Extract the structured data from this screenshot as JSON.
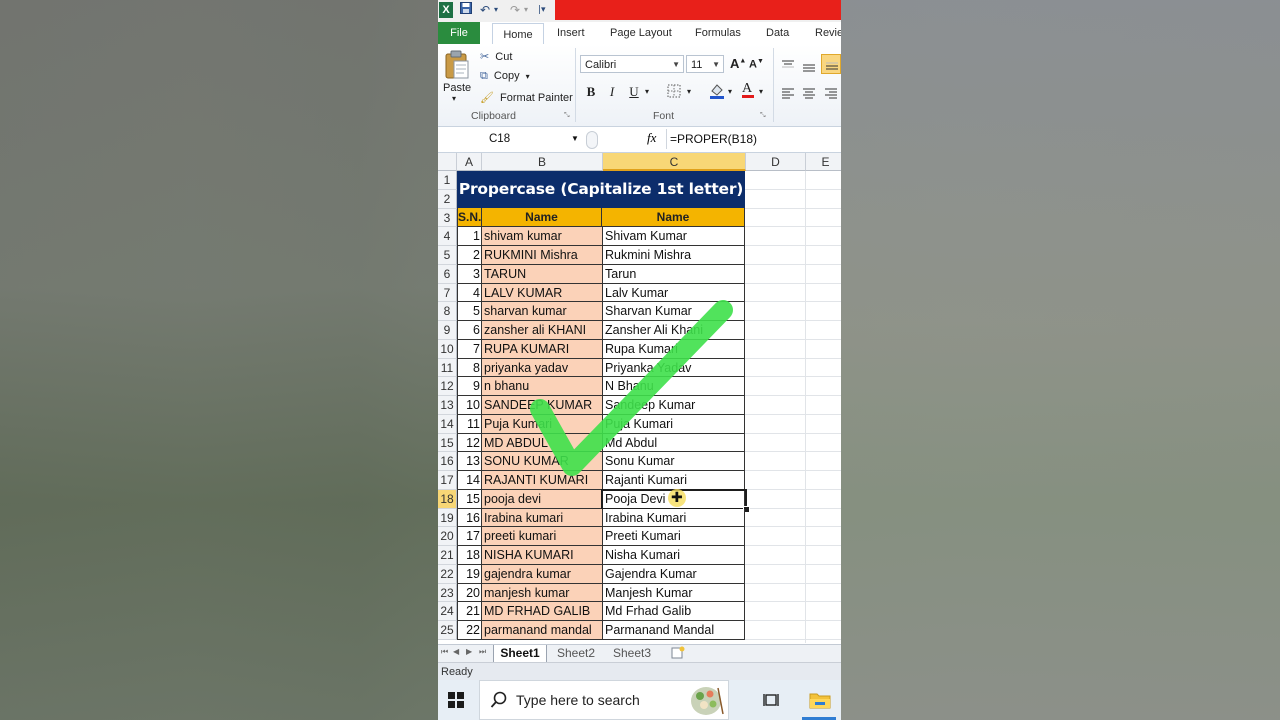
{
  "quick_access": {
    "undo": "↶",
    "redo": "↷"
  },
  "ribbon_tabs": [
    "File",
    "Home",
    "Insert",
    "Page Layout",
    "Formulas",
    "Data",
    "Revie"
  ],
  "clipboard": {
    "paste_label": "Paste",
    "cut_label": "Cut",
    "copy_label": "Copy",
    "format_painter_label": "Format Painter",
    "group_label": "Clipboard"
  },
  "font": {
    "font_name": "Calibri",
    "font_size": "11",
    "bold": "B",
    "italic": "I",
    "underline": "U",
    "group_label": "Font"
  },
  "formula_bar": {
    "name_box": "C18",
    "fx": "fx",
    "formula": "=PROPER(B18)"
  },
  "columns": [
    "A",
    "B",
    "C",
    "D",
    "E"
  ],
  "sheet": {
    "title": "Propercase (Capitalize 1st letter)",
    "headers": {
      "sn": "S.N.",
      "name_b": "Name",
      "name_c": "Name"
    },
    "rows": [
      {
        "row": "4",
        "sn": "1",
        "b": "shivam kumar",
        "c": "Shivam Kumar"
      },
      {
        "row": "5",
        "sn": "2",
        "b": "RUKMINI Mishra",
        "c": "Rukmini Mishra"
      },
      {
        "row": "6",
        "sn": "3",
        "b": "TARUN",
        "c": "Tarun"
      },
      {
        "row": "7",
        "sn": "4",
        "b": "LALV KUMAR",
        "c": "Lalv Kumar"
      },
      {
        "row": "8",
        "sn": "5",
        "b": "sharvan kumar",
        "c": "Sharvan Kumar"
      },
      {
        "row": "9",
        "sn": "6",
        "b": "zansher ali KHANI",
        "c": "Zansher Ali Khani"
      },
      {
        "row": "10",
        "sn": "7",
        "b": "RUPA KUMARI",
        "c": "Rupa Kumari"
      },
      {
        "row": "11",
        "sn": "8",
        "b": "priyanka yadav",
        "c": "Priyanka Yadav"
      },
      {
        "row": "12",
        "sn": "9",
        "b": "n bhanu",
        "c": "N Bhanu"
      },
      {
        "row": "13",
        "sn": "10",
        "b": "SANDEEP KUMAR",
        "c": "Sandeep Kumar"
      },
      {
        "row": "14",
        "sn": "11",
        "b": "Puja Kumari",
        "c": "Puja Kumari"
      },
      {
        "row": "15",
        "sn": "12",
        "b": "MD ABDUL",
        "c": "Md Abdul"
      },
      {
        "row": "16",
        "sn": "13",
        "b": "SONU KUMAR",
        "c": "Sonu Kumar"
      },
      {
        "row": "17",
        "sn": "14",
        "b": "RAJANTI KUMARI",
        "c": "Rajanti Kumari"
      },
      {
        "row": "18",
        "sn": "15",
        "b": "pooja devi",
        "c": "Pooja Devi"
      },
      {
        "row": "19",
        "sn": "16",
        "b": "Irabina kumari",
        "c": "Irabina Kumari"
      },
      {
        "row": "20",
        "sn": "17",
        "b": "preeti kumari",
        "c": "Preeti Kumari"
      },
      {
        "row": "21",
        "sn": "18",
        "b": "NISHA KUMARI",
        "c": "Nisha Kumari"
      },
      {
        "row": "22",
        "sn": "19",
        "b": "gajendra kumar",
        "c": "Gajendra Kumar"
      },
      {
        "row": "23",
        "sn": "20",
        "b": "manjesh kumar",
        "c": "Manjesh Kumar"
      },
      {
        "row": "24",
        "sn": "21",
        "b": "MD FRHAD GALIB",
        "c": "Md Frhad Galib"
      },
      {
        "row": "25",
        "sn": "22",
        "b": "parmanand mandal",
        "c": "Parmanand Mandal"
      }
    ]
  },
  "sheet_tabs": [
    "Sheet1",
    "Sheet2",
    "Sheet3"
  ],
  "status": "Ready",
  "taskbar": {
    "search_placeholder": "Type here to search"
  },
  "colors": {
    "title_bg": "#0c2d6b",
    "header_bg": "#f4b400",
    "source_col_bg": "#fbd2b8",
    "file_tab": "#2a8c3e",
    "checkmark": "#3ee04a"
  }
}
